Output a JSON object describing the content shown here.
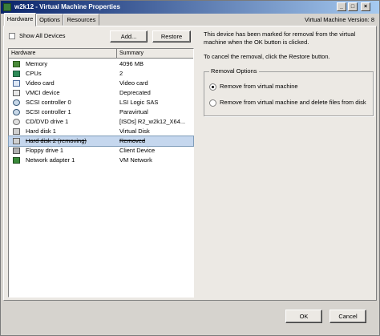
{
  "window": {
    "title": "w2k12 - Virtual Machine Properties",
    "controls": {
      "minimize": "_",
      "maximize": "□",
      "close": "×"
    }
  },
  "tabs": [
    {
      "label": "Hardware",
      "active": true
    },
    {
      "label": "Options",
      "active": false
    },
    {
      "label": "Resources",
      "active": false
    }
  ],
  "version_label": "Virtual Machine Version: 8",
  "hardware": {
    "show_all_devices_label": "Show All Devices",
    "show_all_devices_checked": false,
    "add_button": "Add...",
    "restore_button": "Restore",
    "columns": {
      "hardware": "Hardware",
      "summary": "Summary"
    },
    "rows": [
      {
        "name": "Memory",
        "summary": "4096 MB",
        "icon": "memory-icon"
      },
      {
        "name": "CPUs",
        "summary": "2",
        "icon": "cpu-icon"
      },
      {
        "name": "Video card",
        "summary": "Video card",
        "icon": "video-card-icon"
      },
      {
        "name": "VMCI device",
        "summary": "Deprecated",
        "icon": "vmci-icon"
      },
      {
        "name": "SCSI controller 0",
        "summary": "LSI Logic SAS",
        "icon": "scsi-icon"
      },
      {
        "name": "SCSI controller 1",
        "summary": "Paravirtual",
        "icon": "scsi-icon"
      },
      {
        "name": "CD/DVD drive 1",
        "summary": "[ISOs] R2_w2k12_X64...",
        "icon": "cd-drive-icon"
      },
      {
        "name": "Hard disk 1",
        "summary": "Virtual Disk",
        "icon": "hard-disk-icon"
      },
      {
        "name": "Hard disk 2 (removing)",
        "summary": "Removed",
        "icon": "hard-disk-icon",
        "selected": true,
        "removed": true
      },
      {
        "name": "Floppy drive 1",
        "summary": "Client Device",
        "icon": "floppy-icon"
      },
      {
        "name": "Network adapter 1",
        "summary": "VM Network",
        "icon": "network-adapter-icon"
      }
    ]
  },
  "details": {
    "message1": "This device has been marked for removal from the virtual machine when the OK button is clicked.",
    "message2": "To cancel the removal, click the Restore button.",
    "removal_options": {
      "label": "Removal Options",
      "option1": "Remove from virtual machine",
      "option2": "Remove from virtual machine and delete files from disk",
      "selected": "option1"
    }
  },
  "footer": {
    "ok": "OK",
    "cancel": "Cancel"
  },
  "colors": {
    "title_start": "#0a246a",
    "title_end": "#a6caf0",
    "selection": "#c5d7ee"
  }
}
